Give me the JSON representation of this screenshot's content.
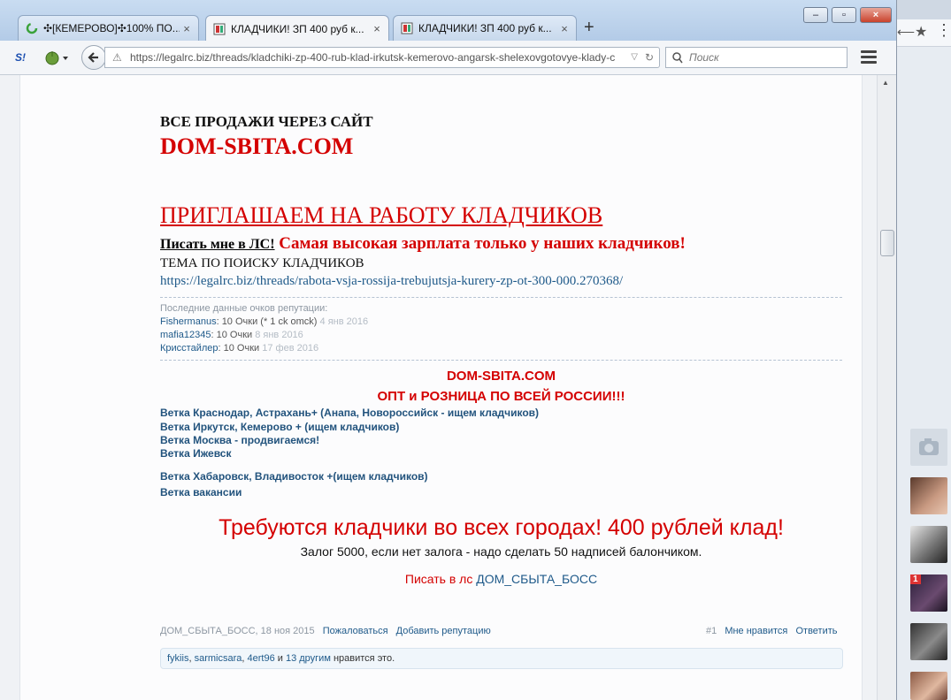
{
  "browser": {
    "tabs": [
      {
        "title": "✣[КЕМЕРОВО]✣100% ПО..."
      },
      {
        "title": "КЛАДЧИКИ! ЗП 400 руб к..."
      },
      {
        "title": "КЛАДЧИКИ! ЗП 400 руб к..."
      }
    ],
    "new_tab": "+",
    "close_glyph": "×",
    "win_minimize": "–",
    "win_maximize": "▫",
    "win_close": "×",
    "url": "https://legalrc.biz/threads/kladchiki-zp-400-rub-klad-irkutsk-kemerovo-angarsk-shelexovgotovye-klady-c",
    "search_placeholder": "Поиск",
    "addon_label": "S!"
  },
  "post": {
    "sales_heading": "ВСЕ ПРОДАЖИ ЧЕРЕЗ САЙТ",
    "site_name": "DOM-SBITA.COM",
    "invite_heading": "ПРИГЛАШАЕМ НА РАБОТУ КЛАДЧИКОВ",
    "write_pm": "Писать мне в ЛС!",
    "salary_line": " Самая высокая зарплата только у наших кладчиков!",
    "topic_label": "ТЕМА ПО ПОИСКУ КЛАДЧИКОВ",
    "topic_link": "https://legalrc.biz/threads/rabota-vsja-rossija-trebujutsja-kurery-zp-ot-300-000.270368/",
    "reputation": {
      "title": "Последние данные очков репутации:",
      "entries": [
        {
          "user": "Fishermanus",
          "points": ": 10 Очки (* 1 ck omck)",
          "date": "4 янв 2016"
        },
        {
          "user": "mafia12345",
          "points": ": 10 Очки",
          "date": "8 янв 2016"
        },
        {
          "user": "Крисстайлер",
          "points": ": 10 Очки",
          "date": "17 фев 2016"
        }
      ]
    },
    "sig_site": "DOM-SBITA.COM",
    "sig_slogan": "ОПТ и РОЗНИЦА ПО ВСЕЙ РОССИИ!!!",
    "branches": [
      "Ветка Краснодар, Астрахань+ (Анапа, Новороссийск - ищем кладчиков)",
      "Ветка Иркутск, Кемерово + (ищем кладчиков)",
      "Ветка Москва - продвигаемся!",
      "Ветка Ижевск",
      "Ветка Хабаровск, Владивосток +(ищем кладчиков)",
      "Ветка вакансии"
    ],
    "big_headline": "Требуются кладчики во всех городах! 400 рублей клад!",
    "deposit_line": "Залог 5000, если нет залога - надо сделать 50 надписей балончиком.",
    "write_in_pm": "Писать в лс ",
    "boss_name": "ДОМ_СБЫТА_БОСС",
    "meta": {
      "author": "ДОМ_СБЫТА_БОСС",
      "date": ", 18 ноя 2015",
      "report": "Пожаловаться",
      "add_rep": "Добавить репутацию",
      "post_number": "#1",
      "like": "Мне нравится",
      "reply": "Ответить"
    },
    "likes": {
      "u1": "fykiis",
      "sep1": ", ",
      "u2": "sarmicsara",
      "sep2": ", ",
      "u3": "4ert96",
      "sep3": " и ",
      "others": "13 другим",
      "suffix": " нравится это."
    }
  },
  "side": {
    "badge": "1"
  },
  "colors": {
    "red": "#d40000",
    "link": "#1f5a8a"
  }
}
